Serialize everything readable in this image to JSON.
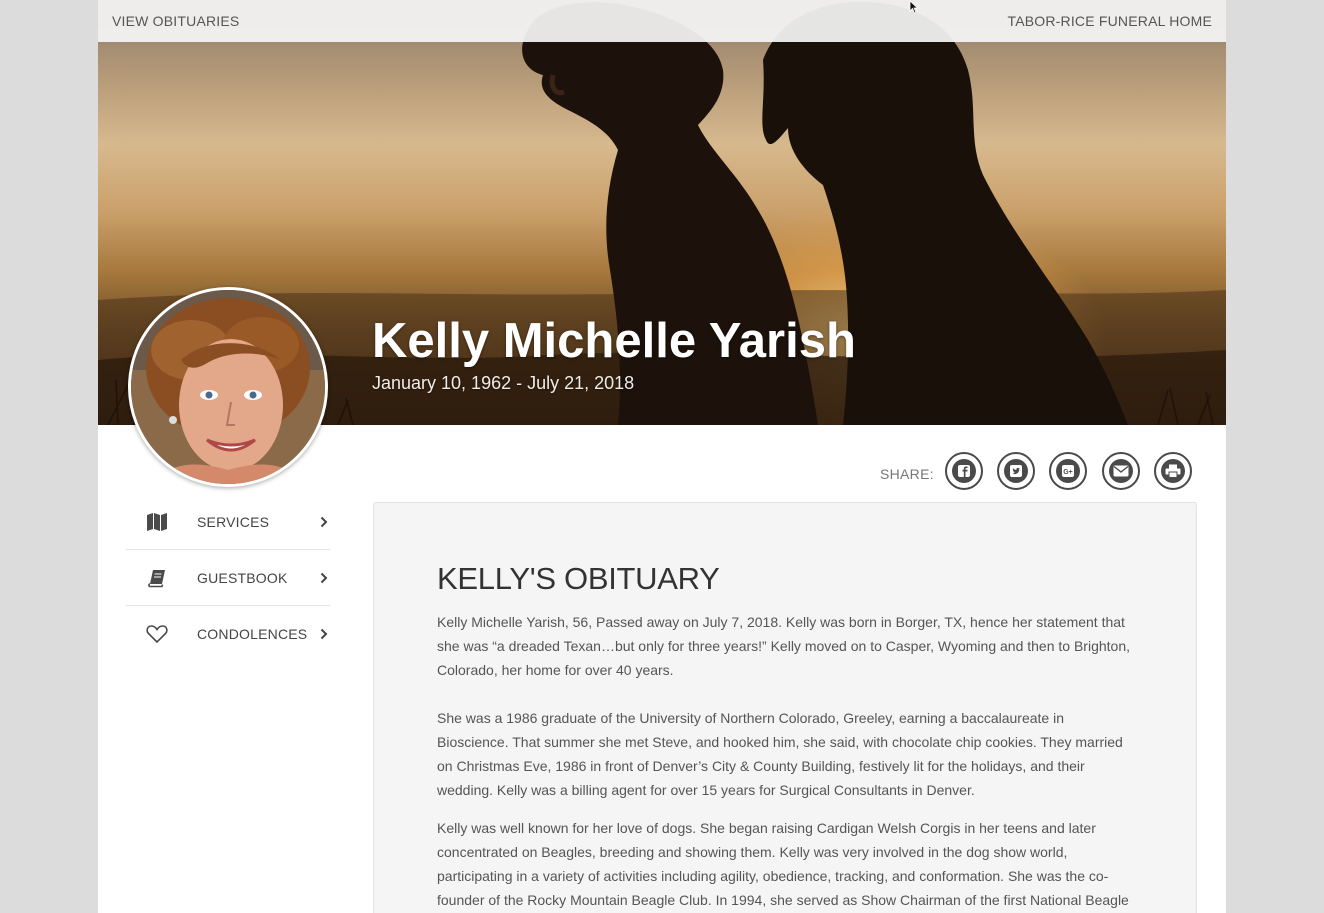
{
  "topbar": {
    "left_link": "VIEW OBITUARIES",
    "right_link": "TABOR-RICE FUNERAL HOME"
  },
  "hero": {
    "name": "Kelly Michelle Yarish",
    "dates": "January 10, 1962 - July 21, 2018"
  },
  "share": {
    "label": "SHARE:",
    "buttons": [
      {
        "icon": "facebook-icon",
        "glyph": "f"
      },
      {
        "icon": "twitter-icon",
        "glyph": "t"
      },
      {
        "icon": "google-plus-icon",
        "glyph": "G+"
      },
      {
        "icon": "email-icon",
        "glyph": "✉"
      },
      {
        "icon": "print-icon",
        "glyph": "⎙"
      }
    ]
  },
  "sidebar": {
    "items": [
      {
        "label": "SERVICES",
        "icon": "map-icon"
      },
      {
        "label": "GUESTBOOK",
        "icon": "book-icon"
      },
      {
        "label": "CONDOLENCES",
        "icon": "heart-icon"
      }
    ]
  },
  "obituary": {
    "heading": "KELLY'S OBITUARY",
    "paragraphs": [
      "Kelly Michelle Yarish, 56, Passed away on July 7, 2018.  Kelly was born in Borger, TX, hence her statement that she was “a dreaded Texan…but only for three years!”  Kelly moved on to Casper, Wyoming and then to Brighton, Colorado, her home for over 40 years.",
      "She was a 1986 graduate of the University of Northern Colorado, Greeley, earning a baccalaureate in Bioscience.  That summer she met Steve, and hooked him, she said, with chocolate chip cookies. They married on Christmas Eve, 1986 in front of Denver’s City & County Building, festively lit for the holidays, and their wedding. Kelly was a billing agent for over 15 years for Surgical Consultants in Denver.",
      "Kelly was well known for her love of dogs. She began raising Cardigan Welsh Corgis in her teens and later concentrated on Beagles, breeding and showing them. Kelly was very involved in the dog show world, participating in a variety of activities including agility, obedience, tracking, and conformation. She was the co-founder of the Rocky Mountain Beagle Club. In 1994, she served as Show Chairman of the first National Beagle"
    ]
  },
  "colors": {
    "page_bg": "#dcdcdc",
    "card_bg": "#f5f5f5",
    "text": "#555555",
    "icon": "#4a4a4a"
  }
}
